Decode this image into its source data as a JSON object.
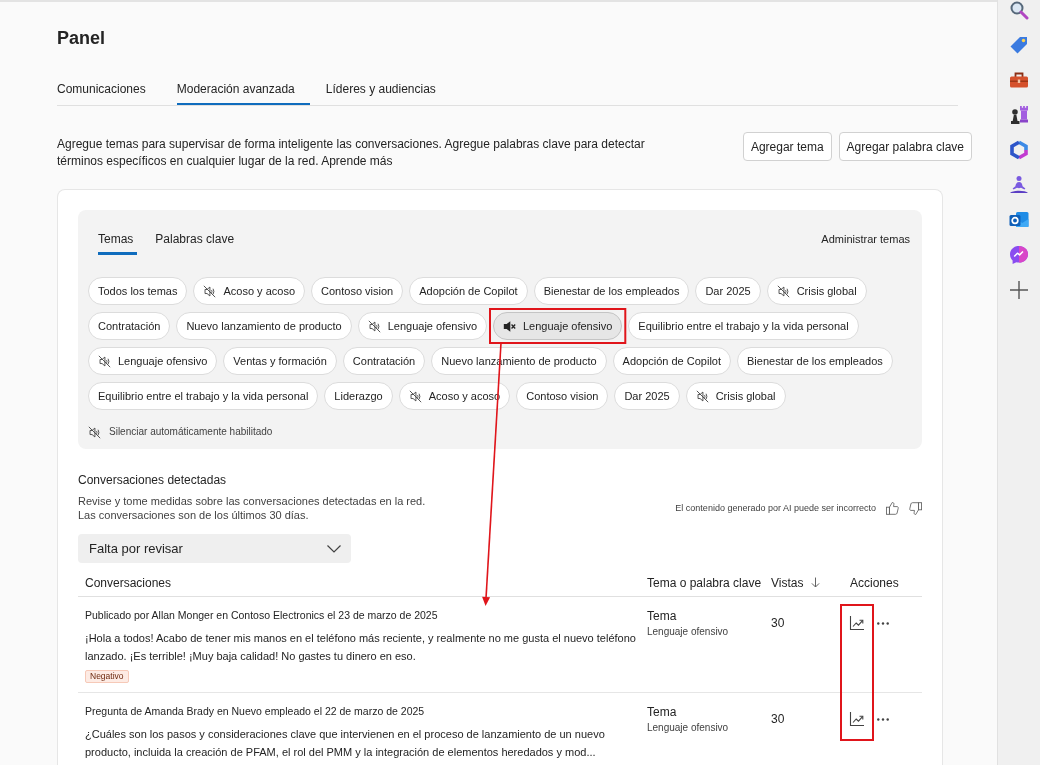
{
  "header": {
    "title": "Panel"
  },
  "tabs": [
    {
      "label": "Comunicaciones",
      "selected": false
    },
    {
      "label": "Moderación avanzada",
      "selected": true
    },
    {
      "label": "Líderes y audiencias",
      "selected": false
    }
  ],
  "intro": {
    "text": "Agregue temas para supervisar de forma inteligente las conversaciones. Agregue palabras clave para detectar términos específicos en cualquier lugar de la red. Aprende más"
  },
  "actions": [
    "Agregar tema",
    "Agregar palabra clave"
  ],
  "topics_panel": {
    "tabs": [
      {
        "label": "Temas",
        "selected": true
      },
      {
        "label": "Palabras clave",
        "selected": false
      }
    ],
    "manage_link": "Administrar temas",
    "chips": [
      {
        "label": "Todos los temas",
        "muted": false,
        "selected": false,
        "annotated": false
      },
      {
        "label": "Acoso y acoso",
        "muted": true,
        "selected": false,
        "annotated": false
      },
      {
        "label": "Contoso vision",
        "muted": false,
        "selected": false,
        "annotated": false
      },
      {
        "label": "Adopción de Copilot",
        "muted": false,
        "selected": false,
        "annotated": false
      },
      {
        "label": "Bienestar de los empleados",
        "muted": false,
        "selected": false,
        "annotated": false
      },
      {
        "label": "Dar 2025",
        "muted": false,
        "selected": false,
        "annotated": false
      },
      {
        "label": "Crisis global",
        "muted": true,
        "selected": false,
        "annotated": false
      },
      {
        "label": "Contratación",
        "muted": false,
        "selected": false,
        "annotated": false
      },
      {
        "label": "Nuevo lanzamiento de producto",
        "muted": false,
        "selected": false,
        "annotated": false
      },
      {
        "label": "Lenguaje ofensivo",
        "muted": true,
        "selected": false,
        "annotated": false
      },
      {
        "label": "Lenguaje ofensivo",
        "muted": true,
        "selected": true,
        "annotated": true
      },
      {
        "label": "Equilibrio entre el trabajo y la vida personal",
        "muted": false,
        "selected": false,
        "annotated": false
      },
      {
        "label": "Lenguaje ofensivo",
        "muted": true,
        "selected": false,
        "annotated": false
      },
      {
        "label": "Ventas y formación",
        "muted": false,
        "selected": false,
        "annotated": false
      },
      {
        "label": "Contratación",
        "muted": false,
        "selected": false,
        "annotated": false
      },
      {
        "label": "Nuevo lanzamiento de producto",
        "muted": false,
        "selected": false,
        "annotated": false
      },
      {
        "label": "Adopción de Copilot",
        "muted": false,
        "selected": false,
        "annotated": false
      },
      {
        "label": "Bienestar de los empleados",
        "muted": false,
        "selected": false,
        "annotated": false
      },
      {
        "label": "Equilibrio entre el trabajo y la vida personal",
        "muted": false,
        "selected": false,
        "annotated": false
      },
      {
        "label": "Liderazgo",
        "muted": false,
        "selected": false,
        "annotated": false
      },
      {
        "label": "Acoso y acoso",
        "muted": true,
        "selected": false,
        "annotated": false
      },
      {
        "label": "Contoso vision",
        "muted": false,
        "selected": false,
        "annotated": false
      },
      {
        "label": "Dar 2025",
        "muted": false,
        "selected": false,
        "annotated": false
      },
      {
        "label": "Crisis global",
        "muted": true,
        "selected": false,
        "annotated": false
      }
    ],
    "auto_mute_note": "Silenciar automáticamente habilitado"
  },
  "conversations": {
    "title": "Conversaciones detectadas",
    "description": [
      "Revise y tome medidas sobre las conversaciones detectadas en la red.",
      "Las conversaciones son de los últimos 30 días."
    ],
    "ai_notice": "El contenido generado por AI puede ser incorrecto",
    "filter": {
      "value": "Falta por revisar"
    },
    "columns": [
      {
        "label": "Conversaciones",
        "sorted": false
      },
      {
        "label": "Tema o palabra clave",
        "sorted": false
      },
      {
        "label": "Vistas",
        "sorted": true
      },
      {
        "label": "Acciones",
        "sorted": false
      }
    ],
    "rows": [
      {
        "meta": "Publicado por Allan Monger en Contoso Electronics el 23 de marzo de 2025",
        "text": "¡Hola a todos! Acabo de tener mis manos en el teléfono más reciente, y realmente no me gusta el nuevo teléfono lanzado. ¡Es terrible! ¡Muy baja calidad! No gastes tu dinero en eso.",
        "sentiment": "Negativo",
        "topic_type": "Tema",
        "topic": "Lenguaje ofensivo",
        "views": "30"
      },
      {
        "meta": "Pregunta de Amanda Brady en Nuevo empleado el 22 de marzo de 2025",
        "text": "¿Cuáles son los pasos y consideraciones clave que intervienen en el proceso de lanzamiento de un nuevo producto, incluida la creación de PFAM, el rol del PMM y la integración de elementos heredados y mod...",
        "topic_type": "Tema",
        "topic": "Lenguaje ofensivo",
        "views": "30"
      }
    ],
    "actions_annotated": true
  },
  "app_bar": [
    {
      "kind": "search"
    },
    {
      "kind": "tag"
    },
    {
      "kind": "toolbox"
    },
    {
      "kind": "chess"
    },
    {
      "kind": "ring"
    },
    {
      "kind": "meditation"
    },
    {
      "kind": "mail"
    },
    {
      "kind": "chat"
    },
    {
      "kind": "add"
    }
  ]
}
